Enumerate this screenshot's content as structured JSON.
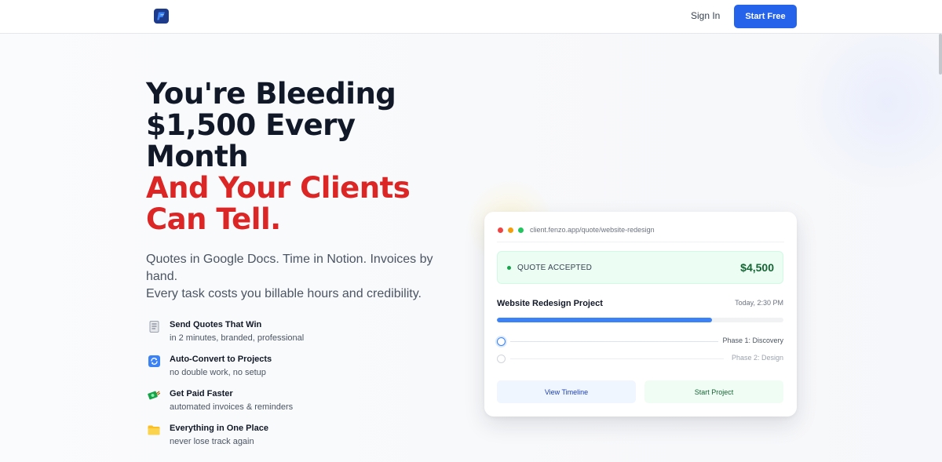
{
  "header": {
    "logo_icon": "fenzo-logo-icon",
    "sign_in": "Sign In",
    "start_free": "Start Free"
  },
  "hero": {
    "title_lines_dark": [
      "You're Bleeding",
      "$1,500 Every",
      "Month"
    ],
    "title_lines_red": [
      "And Your Clients",
      "Can Tell."
    ],
    "subtitle_line1": "Quotes in Google Docs. Time in Notion. Invoices by hand.",
    "subtitle_line2": "Every task costs you billable hours and credibility."
  },
  "features": [
    {
      "icon": "document-icon",
      "title": "Send Quotes That Win",
      "subtitle": "in 2 minutes, branded, professional"
    },
    {
      "icon": "refresh-icon",
      "title": "Auto-Convert to Projects",
      "subtitle": "no double work, no setup"
    },
    {
      "icon": "money-icon",
      "title": "Get Paid Faster",
      "subtitle": "automated invoices & reminders"
    },
    {
      "icon": "folder-icon",
      "title": "Everything in One Place",
      "subtitle": "never lose track again"
    }
  ],
  "card": {
    "url": "client.fenzo.app/quote/website-redesign",
    "status_label": "QUOTE ACCEPTED",
    "amount": "$4,500",
    "project_name": "Website Redesign Project",
    "timestamp": "Today, 2:30 PM",
    "progress": 0.75,
    "phases": [
      {
        "label": "Phase 1: Discovery",
        "active": true
      },
      {
        "label": "Phase 2: Design",
        "active": false
      }
    ],
    "view_timeline": "View Timeline",
    "start_project": "Start Project"
  },
  "colors": {
    "primary": "#2563eb",
    "accent_red": "#dc2626",
    "success": "#16a34a",
    "window_dots": [
      "#ef4444",
      "#f59e0b",
      "#22c55e"
    ]
  }
}
